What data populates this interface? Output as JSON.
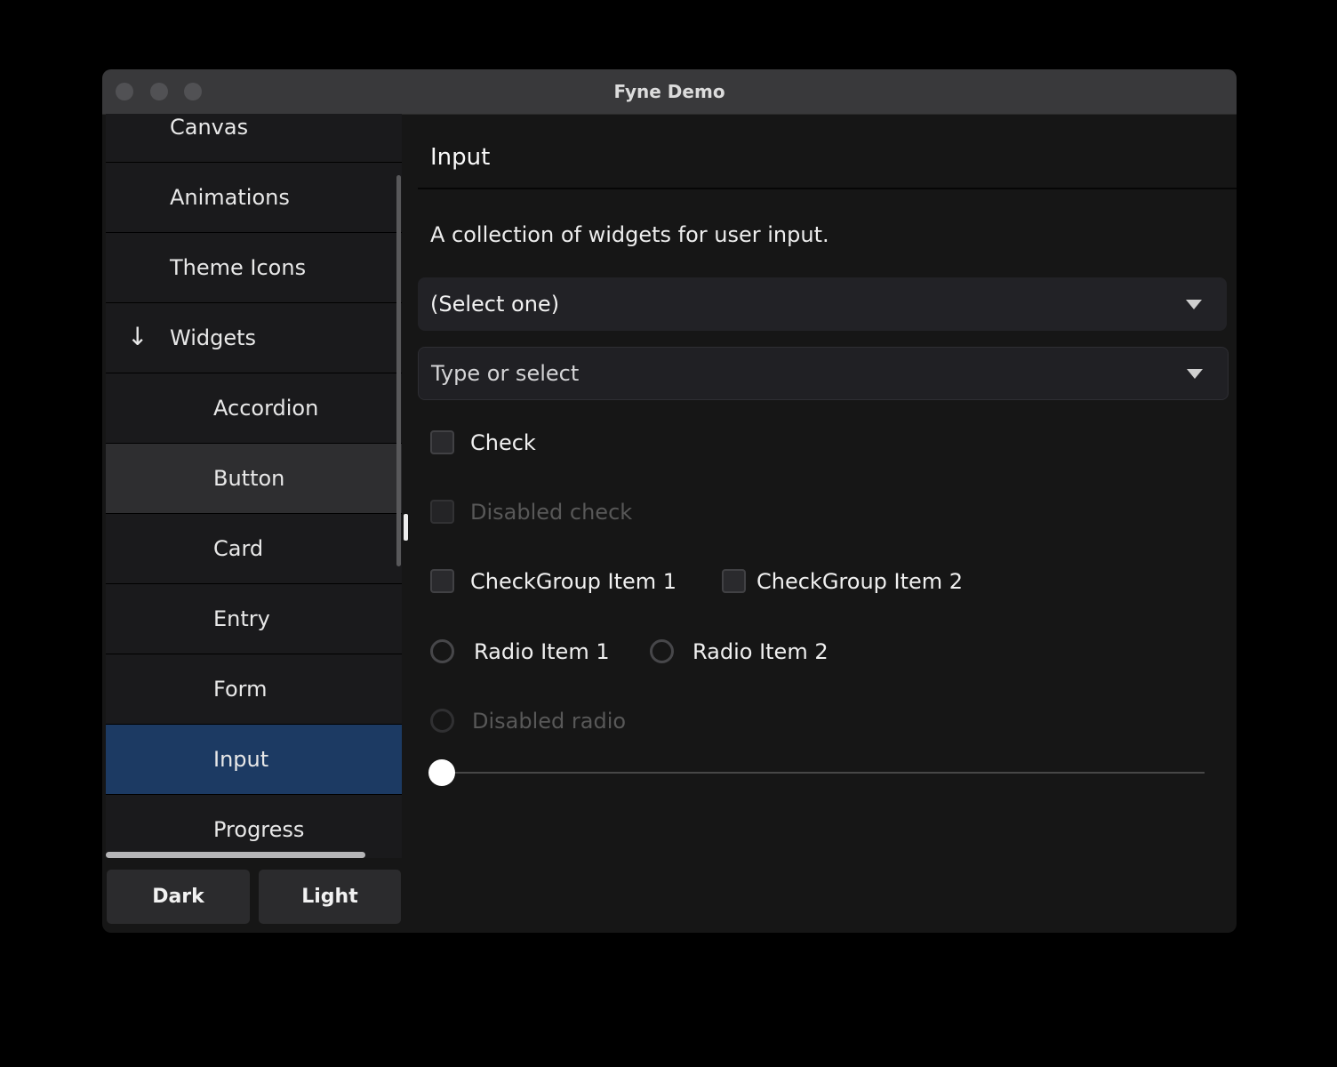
{
  "window": {
    "title": "Fyne Demo"
  },
  "sidebar": {
    "items": [
      {
        "label": "Canvas"
      },
      {
        "label": "Animations"
      },
      {
        "label": "Theme Icons"
      },
      {
        "label": "Widgets"
      },
      {
        "label": "Accordion"
      },
      {
        "label": "Button"
      },
      {
        "label": "Card"
      },
      {
        "label": "Entry"
      },
      {
        "label": "Form"
      },
      {
        "label": "Input"
      },
      {
        "label": "Progress"
      }
    ],
    "widgets_arrow": "↓",
    "dark_button": "Dark",
    "light_button": "Light"
  },
  "main": {
    "title": "Input",
    "description": "A collection of widgets for user input.",
    "select_value": "(Select one)",
    "select_entry_placeholder": "Type or select",
    "check_label": "Check",
    "disabled_check_label": "Disabled check",
    "checkgroup": [
      "CheckGroup Item 1",
      "CheckGroup Item 2"
    ],
    "radiogroup": [
      "Radio Item 1",
      "Radio Item 2"
    ],
    "disabled_radio_label": "Disabled radio",
    "slider": {
      "value": 0
    }
  },
  "colors": {
    "selection": "#1c3a63",
    "window_bg": "#161616",
    "titlebar_bg": "#39393b",
    "scrollbar": "#b5b5b7"
  }
}
